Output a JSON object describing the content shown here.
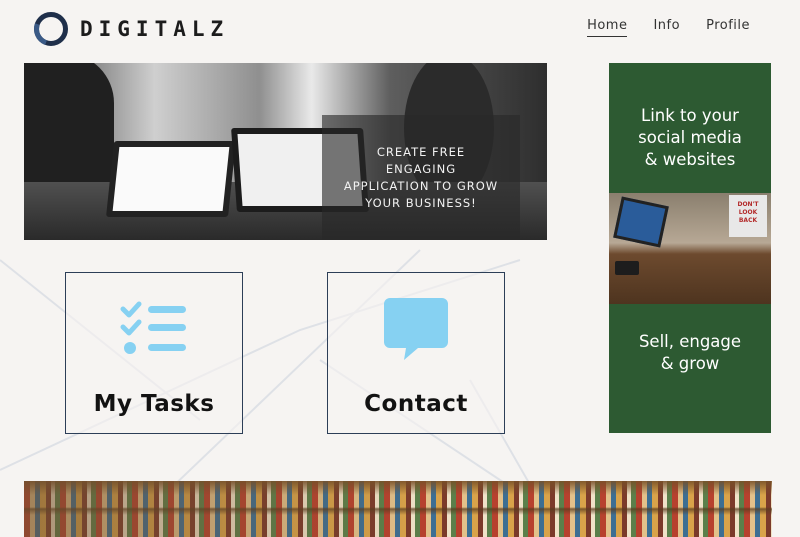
{
  "brand": {
    "name": "DIGITALZ"
  },
  "nav": {
    "items": [
      {
        "label": "Home",
        "active": true
      },
      {
        "label": "Info",
        "active": false
      },
      {
        "label": "Profile",
        "active": false
      }
    ]
  },
  "hero": {
    "caption": "CREATE FREE\nENGAGING\nAPPLICATION TO GROW\nYOUR BUSINESS!"
  },
  "tiles": [
    {
      "label": "My Tasks",
      "icon": "checklist-icon"
    },
    {
      "label": "Contact",
      "icon": "chat-bubble-icon"
    }
  ],
  "side_panel": {
    "top_text": "Link to your\nsocial media\n& websites",
    "bottom_text": "Sell, engage\n& grow",
    "poster_text": "DON'T\nLOOK\nBACK"
  },
  "colors": {
    "accent_green": "#2d5a32",
    "icon_blue": "#86d1f2",
    "dark_navy": "#1f2f4a"
  }
}
